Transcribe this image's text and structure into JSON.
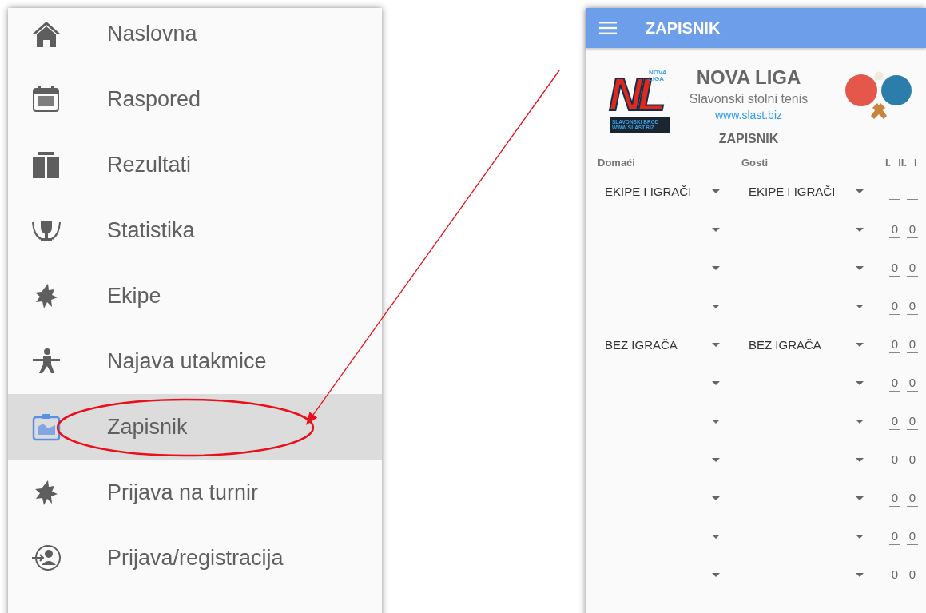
{
  "menu": {
    "items": [
      {
        "label": "Naslovna",
        "selected": false
      },
      {
        "label": "Raspored",
        "selected": false
      },
      {
        "label": "Rezultati",
        "selected": false
      },
      {
        "label": "Statistika",
        "selected": false
      },
      {
        "label": "Ekipe",
        "selected": false
      },
      {
        "label": "Najava utakmice",
        "selected": false
      },
      {
        "label": "Zapisnik",
        "selected": true
      },
      {
        "label": "Prijava na turnir",
        "selected": false
      },
      {
        "label": "Prijava/registracija",
        "selected": false
      }
    ]
  },
  "app_bar": {
    "title": "ZAPISNIK"
  },
  "brand": {
    "logo": {
      "letters": "NL",
      "badge": [
        "NOVA",
        "LIGA"
      ],
      "caption": [
        "SLAVONSKI BROD",
        "WWW.SLAST.BIZ"
      ]
    },
    "name": "NOVA LIGA",
    "subtitle": "Slavonski stolni tenis",
    "link": "www.slast.biz"
  },
  "section_title": "ZAPISNIK",
  "table": {
    "columns": [
      "Domaći",
      "Gosti"
    ],
    "set_columns": [
      "I.",
      "II.",
      "I"
    ],
    "rows": [
      {
        "home": "EKIPE I IGRAČI",
        "guest": "EKIPE I IGRAČI"
      },
      {
        "scores": [
          "0",
          "0"
        ]
      },
      {
        "scores": [
          "0",
          "0"
        ]
      },
      {
        "scores": [
          "0",
          "0"
        ]
      },
      {
        "home": "BEZ IGRAČA",
        "guest": "BEZ IGRAČA",
        "scores": [
          "0",
          "0"
        ]
      },
      {
        "scores": [
          "0",
          "0"
        ]
      },
      {
        "scores": [
          "0",
          "0"
        ]
      },
      {
        "scores": [
          "0",
          "0"
        ]
      },
      {
        "scores": [
          "0",
          "0"
        ]
      },
      {
        "scores": [
          "0",
          "0"
        ]
      },
      {
        "scores": [
          "0",
          "0"
        ]
      }
    ]
  }
}
